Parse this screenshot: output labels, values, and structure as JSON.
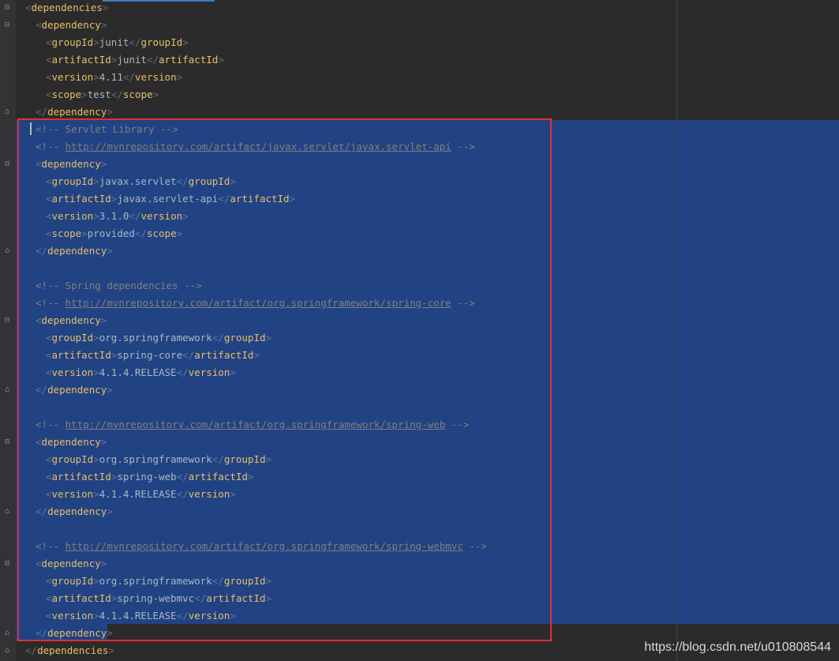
{
  "lines": [
    {
      "kind": "tag",
      "indent": 0,
      "open": true,
      "name": "dependencies"
    },
    {
      "kind": "tag",
      "indent": 1,
      "open": true,
      "name": "dependency"
    },
    {
      "kind": "field",
      "indent": 2,
      "name": "groupId",
      "value": "junit"
    },
    {
      "kind": "field",
      "indent": 2,
      "name": "artifactId",
      "value": "junit"
    },
    {
      "kind": "field",
      "indent": 2,
      "name": "version",
      "value": "4.11"
    },
    {
      "kind": "field",
      "indent": 2,
      "name": "scope",
      "value": "test"
    },
    {
      "kind": "tag",
      "indent": 1,
      "open": false,
      "name": "dependency"
    },
    {
      "kind": "comment",
      "indent": 1,
      "text": "Servlet Library"
    },
    {
      "kind": "url",
      "indent": 1,
      "text": "http://mvnrepository.com/artifact/javax.servlet/javax.servlet-api"
    },
    {
      "kind": "tag",
      "indent": 1,
      "open": true,
      "name": "dependency"
    },
    {
      "kind": "field",
      "indent": 2,
      "name": "groupId",
      "value": "javax.servlet"
    },
    {
      "kind": "field",
      "indent": 2,
      "name": "artifactId",
      "value": "javax.servlet-api"
    },
    {
      "kind": "field",
      "indent": 2,
      "name": "version",
      "value": "3.1.0"
    },
    {
      "kind": "field",
      "indent": 2,
      "name": "scope",
      "value": "provided"
    },
    {
      "kind": "tag",
      "indent": 1,
      "open": false,
      "name": "dependency"
    },
    {
      "kind": "blank"
    },
    {
      "kind": "comment",
      "indent": 1,
      "text": "Spring dependencies"
    },
    {
      "kind": "url",
      "indent": 1,
      "text": "http://mvnrepository.com/artifact/org.springframework/spring-core"
    },
    {
      "kind": "tag",
      "indent": 1,
      "open": true,
      "name": "dependency"
    },
    {
      "kind": "field",
      "indent": 2,
      "name": "groupId",
      "value": "org.springframework"
    },
    {
      "kind": "field",
      "indent": 2,
      "name": "artifactId",
      "value": "spring-core"
    },
    {
      "kind": "field",
      "indent": 2,
      "name": "version",
      "value": "4.1.4.RELEASE"
    },
    {
      "kind": "tag",
      "indent": 1,
      "open": false,
      "name": "dependency"
    },
    {
      "kind": "blank"
    },
    {
      "kind": "url",
      "indent": 1,
      "text": "http://mvnrepository.com/artifact/org.springframework/spring-web"
    },
    {
      "kind": "tag",
      "indent": 1,
      "open": true,
      "name": "dependency"
    },
    {
      "kind": "field",
      "indent": 2,
      "name": "groupId",
      "value": "org.springframework"
    },
    {
      "kind": "field",
      "indent": 2,
      "name": "artifactId",
      "value": "spring-web"
    },
    {
      "kind": "field",
      "indent": 2,
      "name": "version",
      "value": "4.1.4.RELEASE"
    },
    {
      "kind": "tag",
      "indent": 1,
      "open": false,
      "name": "dependency"
    },
    {
      "kind": "blank"
    },
    {
      "kind": "url",
      "indent": 1,
      "text": "http://mvnrepository.com/artifact/org.springframework/spring-webmvc"
    },
    {
      "kind": "tag",
      "indent": 1,
      "open": true,
      "name": "dependency"
    },
    {
      "kind": "field",
      "indent": 2,
      "name": "groupId",
      "value": "org.springframework"
    },
    {
      "kind": "field",
      "indent": 2,
      "name": "artifactId",
      "value": "spring-webmvc"
    },
    {
      "kind": "field",
      "indent": 2,
      "name": "version",
      "value": "4.1.4.RELEASE"
    },
    {
      "kind": "tag",
      "indent": 1,
      "open": false,
      "name": "dependency"
    },
    {
      "kind": "tag",
      "indent": 0,
      "open": false,
      "name": "dependencies"
    }
  ],
  "watermark": "https://blog.csdn.net/u010808544",
  "colors": {
    "background": "#2b2b2b",
    "selection": "#214283",
    "tag": "#e8bf6a",
    "text": "#a9b7c6",
    "comment": "#808080",
    "highlight_box": "#e03030"
  }
}
